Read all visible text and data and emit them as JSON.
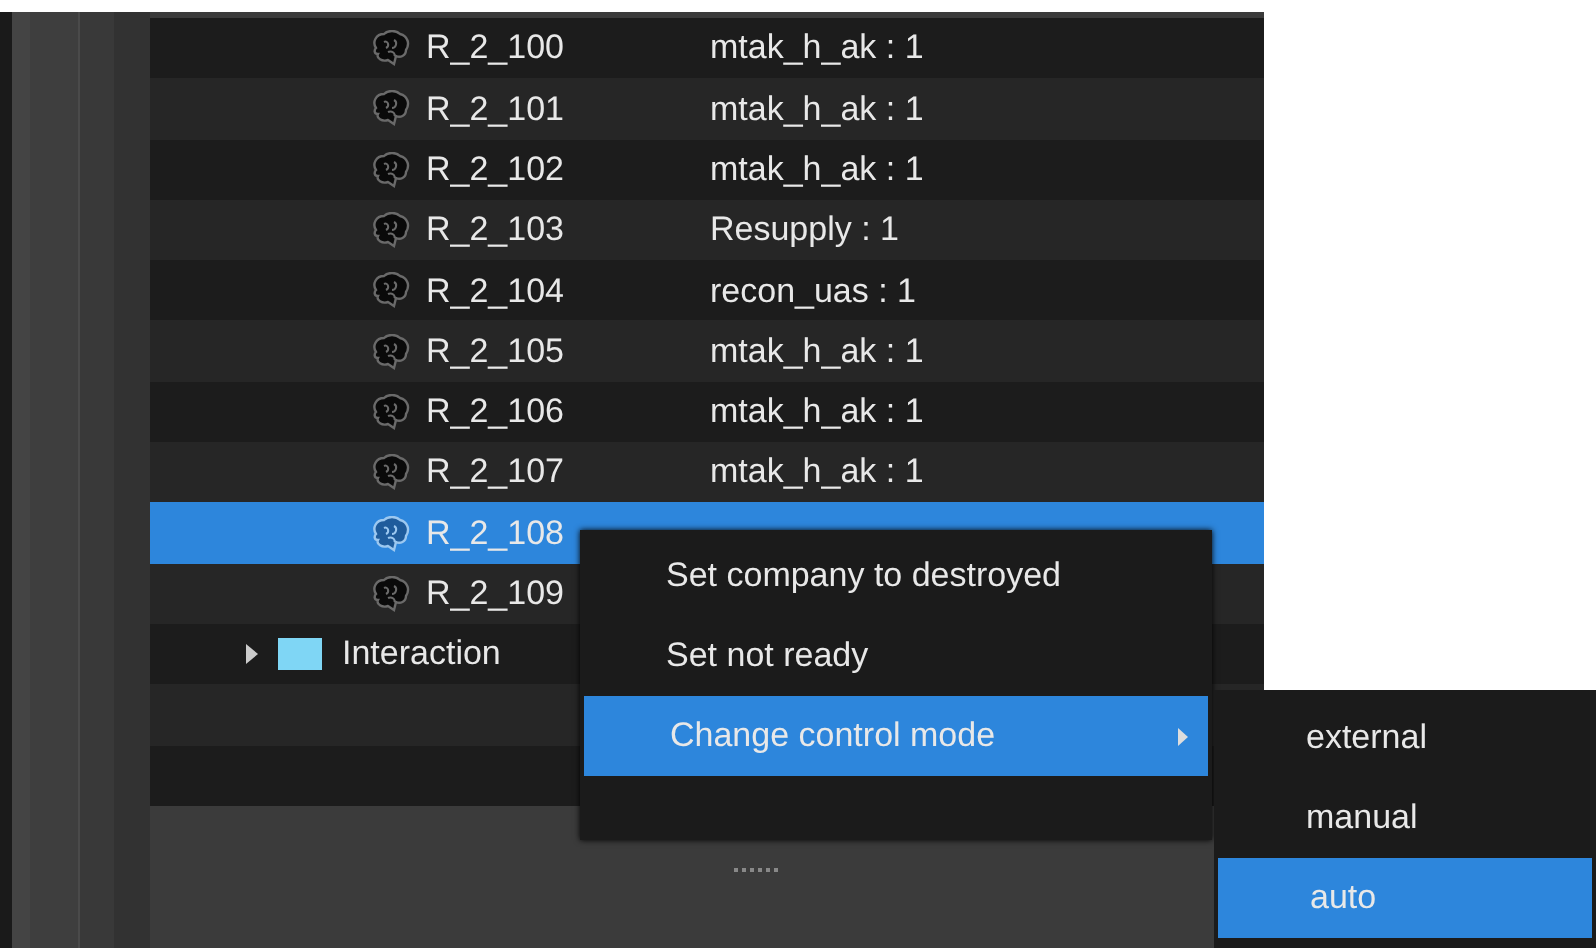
{
  "tree": {
    "rows": [
      {
        "kind": "unit",
        "name": "R_2_100",
        "value": "mtak_h_ak : 1",
        "selected": false
      },
      {
        "kind": "unit",
        "name": "R_2_101",
        "value": "mtak_h_ak : 1",
        "selected": false
      },
      {
        "kind": "unit",
        "name": "R_2_102",
        "value": "mtak_h_ak : 1",
        "selected": false
      },
      {
        "kind": "unit",
        "name": "R_2_103",
        "value": "Resupply : 1",
        "selected": false
      },
      {
        "kind": "unit",
        "name": "R_2_104",
        "value": "recon_uas : 1",
        "selected": false
      },
      {
        "kind": "unit",
        "name": "R_2_105",
        "value": "mtak_h_ak : 1",
        "selected": false
      },
      {
        "kind": "unit",
        "name": "R_2_106",
        "value": "mtak_h_ak : 1",
        "selected": false
      },
      {
        "kind": "unit",
        "name": "R_2_107",
        "value": "mtak_h_ak : 1",
        "selected": false
      },
      {
        "kind": "unit",
        "name": "R_2_108",
        "selected": true
      },
      {
        "kind": "unit",
        "name": "R_2_109",
        "selected": false
      },
      {
        "kind": "group",
        "name": "Interaction",
        "expanded": false,
        "color": "#7fd6f5",
        "selected": false
      }
    ]
  },
  "context_menu": {
    "items": [
      {
        "label": "Set company to destroyed",
        "selected": false,
        "submenu": false
      },
      {
        "label": "Set not ready",
        "selected": false,
        "submenu": false
      },
      {
        "label": "Change control mode",
        "selected": true,
        "submenu": true
      }
    ]
  },
  "submenu": {
    "items": [
      {
        "label": "external",
        "selected": false
      },
      {
        "label": "manual",
        "selected": false
      },
      {
        "label": "auto",
        "selected": true
      }
    ]
  }
}
